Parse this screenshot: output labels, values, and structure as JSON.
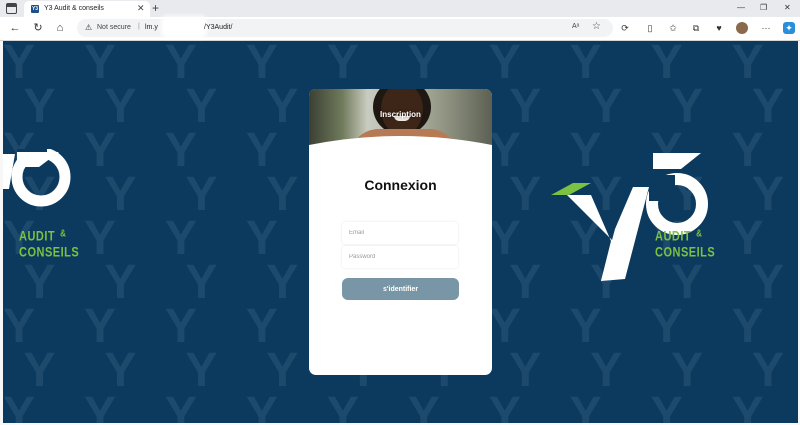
{
  "browser": {
    "tab_title": "Y3 Audit & conseils",
    "favicon_label": "Y3",
    "tab_close": "✕",
    "new_tab": "+",
    "security_label": "Not secure",
    "url_start": "lm.y",
    "url_end": "/Y3Audit/",
    "window_controls": [
      "—",
      "❐",
      "✕"
    ]
  },
  "logo": {
    "mark": "Y3",
    "line1": "AUDIT",
    "amp": "&",
    "line2": "CONSEILS",
    "accent_color": "#7bc142"
  },
  "page": {
    "background_color": "#0c3a5e"
  },
  "card": {
    "banner_title": "Inscription",
    "heading": "Connexion",
    "email_placeholder": "Email",
    "password_placeholder": "Password",
    "submit_label": "s'identifier",
    "button_color": "#7896a5"
  }
}
